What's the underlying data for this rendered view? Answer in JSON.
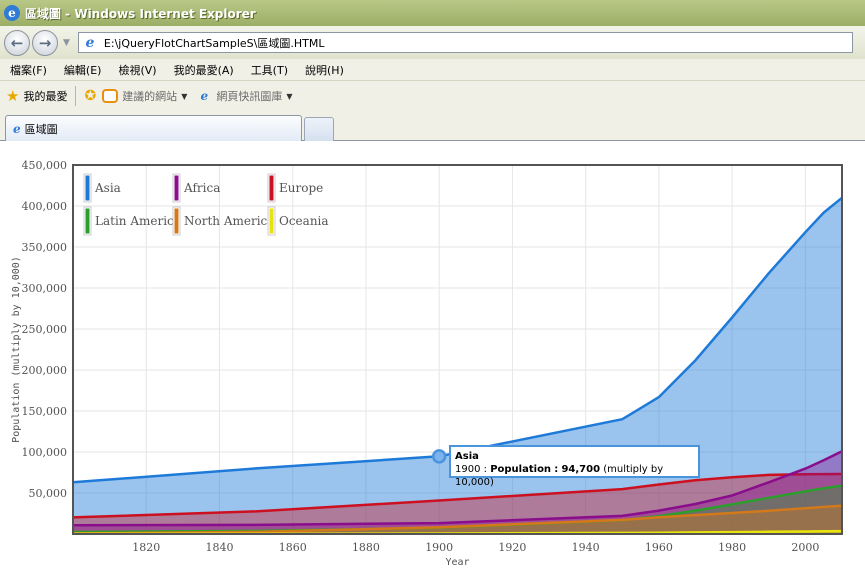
{
  "window": {
    "title": "區域圖 - Windows Internet Explorer"
  },
  "address": {
    "url": "E:\\jQueryFlotChartSampleS\\區域圖.HTML"
  },
  "menu": [
    "檔案(F)",
    "編輯(E)",
    "檢視(V)",
    "我的最愛(A)",
    "工具(T)",
    "說明(H)"
  ],
  "favorites": {
    "label": "我的最愛",
    "suggested": "建議的網站",
    "webslice": "網頁快訊圖庫"
  },
  "tab": {
    "label": "區域圖"
  },
  "tooltip": {
    "series": "Asia",
    "year": "1900",
    "sep": ":",
    "metric": "Population",
    "value_text": "94,700",
    "note": "(multiply by 10,000)"
  },
  "colors": {
    "Asia": "#1e7ad8",
    "Africa": "#8a0d8c",
    "Europe": "#cc1020",
    "Latin America": "#2c9e2c",
    "North America": "#d3791b",
    "Oceania": "#e8e20e"
  },
  "chart_data": {
    "type": "area",
    "xlabel": "Year",
    "ylabel": "Population (multiply by 10,000)",
    "xlim": [
      1800,
      2010
    ],
    "ylim": [
      0,
      450000
    ],
    "x_ticks": [
      "1820",
      "1840",
      "1860",
      "1880",
      "1900",
      "1920",
      "1940",
      "1960",
      "1980",
      "2000"
    ],
    "y_ticks": [
      "50,000",
      "100,000",
      "150,000",
      "200,000",
      "250,000",
      "300,000",
      "350,000",
      "400,000",
      "450,000"
    ],
    "grid": true,
    "legend_position": "top-left",
    "series": [
      {
        "name": "Asia",
        "x": [
          1800,
          1850,
          1900,
          1950,
          1960,
          1970,
          1980,
          1990,
          2000,
          2005,
          2010
        ],
        "values": [
          63000,
          80000,
          94700,
          140000,
          167000,
          212000,
          264000,
          318000,
          368000,
          392000,
          410000
        ]
      },
      {
        "name": "Africa",
        "x": [
          1800,
          1850,
          1900,
          1950,
          1960,
          1970,
          1980,
          1990,
          2000,
          2005,
          2010
        ],
        "values": [
          10700,
          11100,
          13300,
          22100,
          28500,
          36600,
          47000,
          63000,
          79700,
          90000,
          101000
        ]
      },
      {
        "name": "Europe",
        "x": [
          1800,
          1850,
          1900,
          1950,
          1960,
          1970,
          1980,
          1990,
          2000,
          2005,
          2010
        ],
        "values": [
          20300,
          27600,
          40800,
          54700,
          60400,
          65600,
          69200,
          72100,
          72900,
          73100,
          73200
        ]
      },
      {
        "name": "Latin America",
        "x": [
          1800,
          1850,
          1900,
          1950,
          1960,
          1970,
          1980,
          1990,
          2000,
          2005,
          2010
        ],
        "values": [
          2400,
          3800,
          7400,
          16700,
          21800,
          28500,
          36100,
          44100,
          51900,
          55800,
          59000
        ]
      },
      {
        "name": "North America",
        "x": [
          1800,
          1850,
          1900,
          1950,
          1960,
          1970,
          1980,
          1990,
          2000,
          2005,
          2010
        ],
        "values": [
          700,
          2600,
          8200,
          17200,
          20400,
          23100,
          25600,
          28300,
          31500,
          33100,
          34500
        ]
      },
      {
        "name": "Oceania",
        "x": [
          1800,
          1850,
          1900,
          1950,
          1960,
          1970,
          1980,
          1990,
          2000,
          2005,
          2010
        ],
        "values": [
          200,
          200,
          600,
          1300,
          1600,
          1900,
          2300,
          2700,
          3100,
          3300,
          3500
        ]
      }
    ]
  }
}
